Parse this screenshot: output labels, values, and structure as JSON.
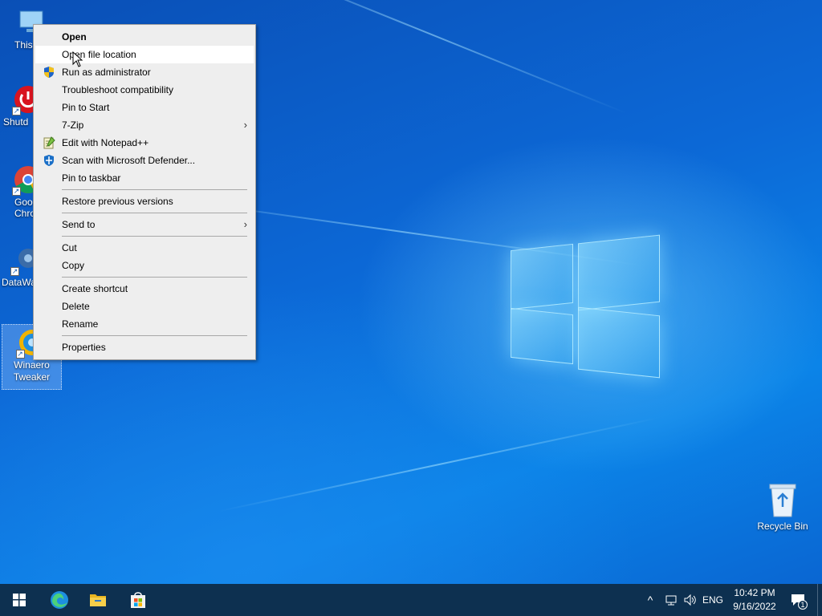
{
  "desktop": {
    "icons": [
      {
        "label": "This"
      },
      {
        "label": "Shutd"
      },
      {
        "label": "Goo Chro"
      },
      {
        "label": "DataWa"
      },
      {
        "label": "Winaero Tweaker"
      }
    ],
    "recycle_bin": {
      "label": "Recycle Bin"
    }
  },
  "context_menu": {
    "items": [
      {
        "label": "Open",
        "bold": true
      },
      {
        "label": "Open file location"
      },
      {
        "label": "Run as administrator",
        "icon": "uac-shield-icon"
      },
      {
        "label": "Troubleshoot compatibility"
      },
      {
        "label": "Pin to Start"
      },
      {
        "label": "7-Zip",
        "submenu": true
      },
      {
        "label": "Edit with Notepad++",
        "icon": "notepad-plus-icon"
      },
      {
        "label": "Scan with Microsoft Defender...",
        "icon": "defender-icon"
      },
      {
        "label": "Pin to taskbar"
      },
      {
        "label": "Restore previous versions"
      },
      {
        "label": "Send to",
        "submenu": true
      },
      {
        "label": "Cut"
      },
      {
        "label": "Copy"
      },
      {
        "label": "Create shortcut"
      },
      {
        "label": "Delete"
      },
      {
        "label": "Rename"
      },
      {
        "label": "Properties"
      }
    ],
    "hovered": "Open file location",
    "submenu_arrow": "›"
  },
  "taskbar": {
    "tray_chevron": "^",
    "language": "ENG",
    "clock": {
      "time": "10:42 PM",
      "date": "9/16/2022"
    },
    "notification_count": "1"
  },
  "colors": {
    "taskbar": "#0d3050",
    "menu_bg": "#eeeeee",
    "menu_hover": "#ffffff",
    "accent": "#0a6fd8"
  }
}
